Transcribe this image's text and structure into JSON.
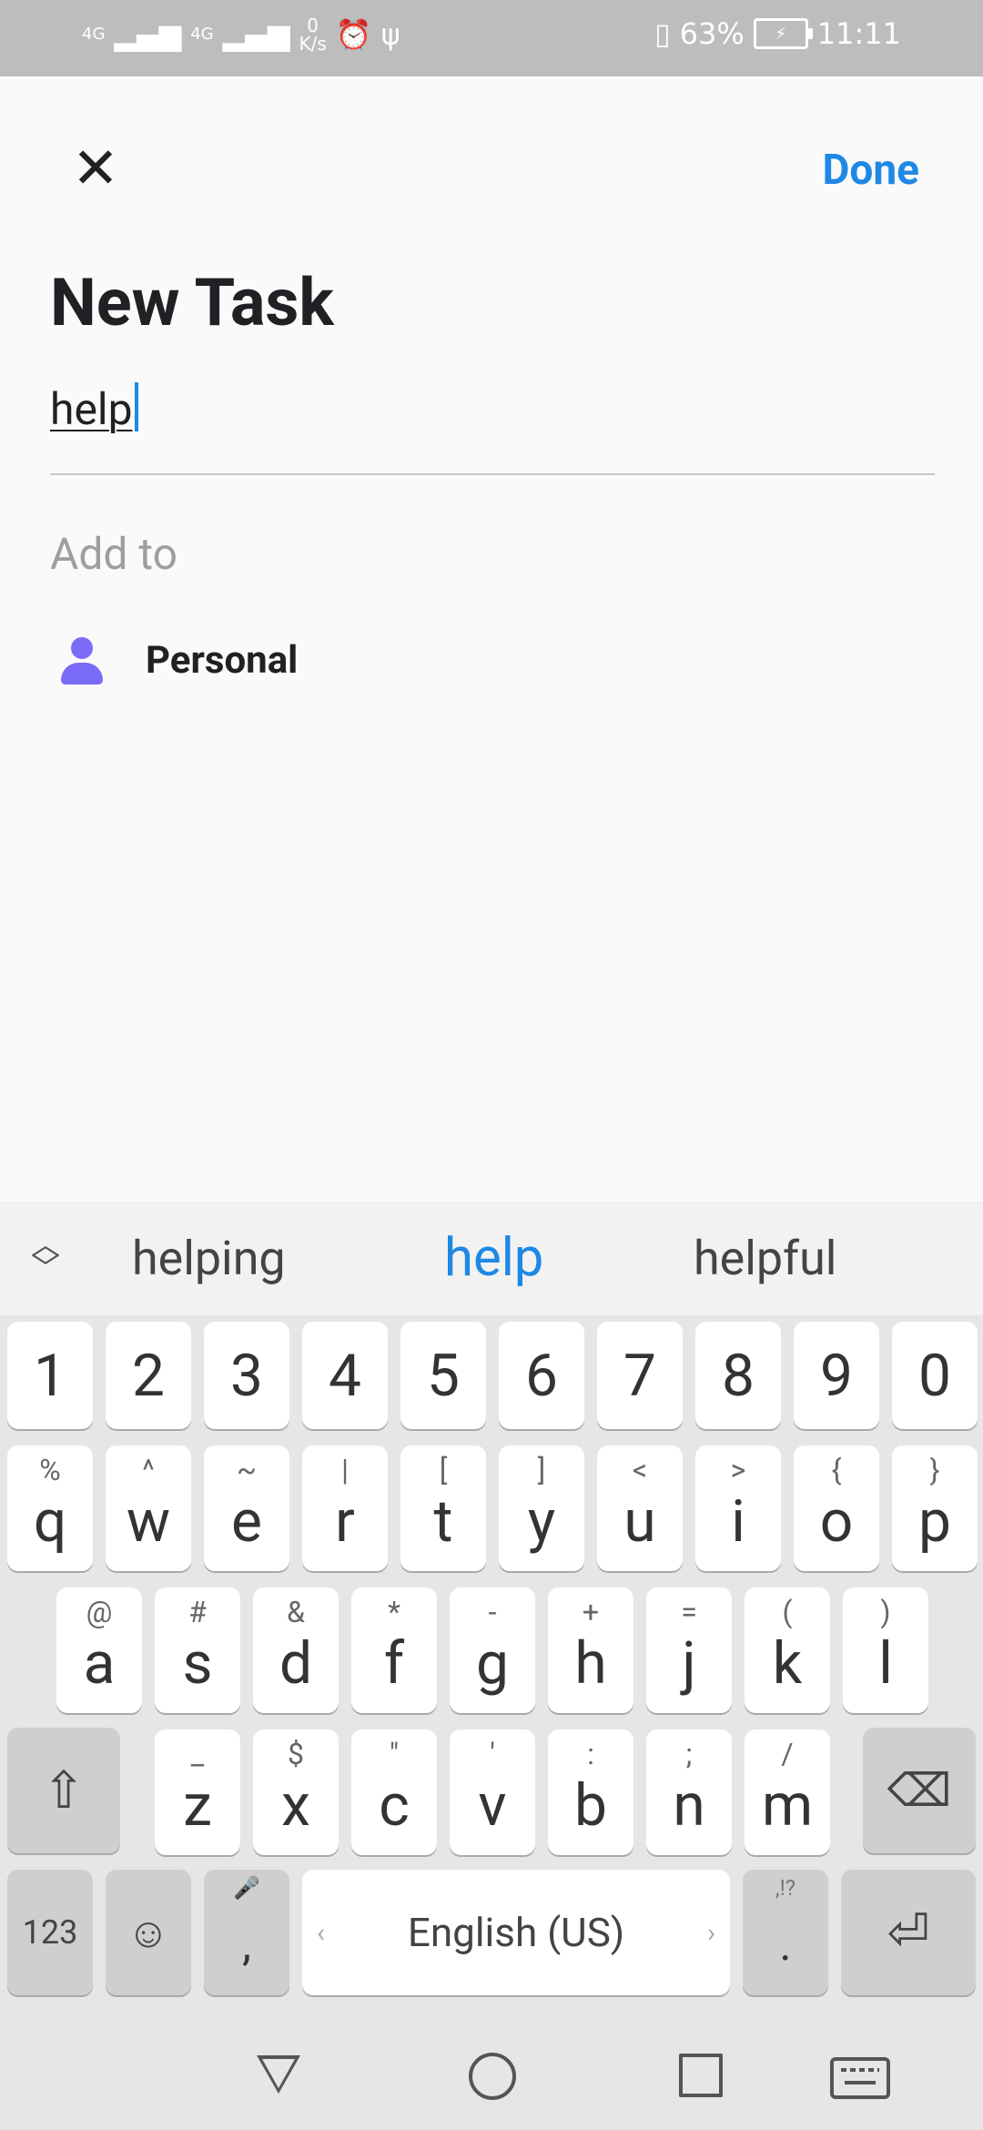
{
  "status_bar": {
    "network1": "4G",
    "network2": "4G",
    "speed_value": "0",
    "speed_unit": "K/s",
    "battery_percent": "63%",
    "time": "11:11",
    "icons": [
      "signal-icon",
      "alarm-icon",
      "usb-icon",
      "vibrate-icon",
      "battery-icon"
    ]
  },
  "header": {
    "close_icon": "close-icon",
    "done_label": "Done"
  },
  "form": {
    "title": "New Task",
    "task_value": "help",
    "add_to_label": "Add to",
    "list": {
      "icon": "person-icon",
      "label": "Personal",
      "icon_color": "#7a6cf6"
    }
  },
  "keyboard": {
    "suggestions": [
      "helping",
      "help",
      "helpful"
    ],
    "number_row": [
      "1",
      "2",
      "3",
      "4",
      "5",
      "6",
      "7",
      "8",
      "9",
      "0"
    ],
    "row1": [
      {
        "main": "q",
        "sub": "%"
      },
      {
        "main": "w",
        "sub": "^"
      },
      {
        "main": "e",
        "sub": "~"
      },
      {
        "main": "r",
        "sub": "|"
      },
      {
        "main": "t",
        "sub": "["
      },
      {
        "main": "y",
        "sub": "]"
      },
      {
        "main": "u",
        "sub": "<"
      },
      {
        "main": "i",
        "sub": ">"
      },
      {
        "main": "o",
        "sub": "{"
      },
      {
        "main": "p",
        "sub": "}"
      }
    ],
    "row2": [
      {
        "main": "a",
        "sub": "@"
      },
      {
        "main": "s",
        "sub": "#"
      },
      {
        "main": "d",
        "sub": "&"
      },
      {
        "main": "f",
        "sub": "*"
      },
      {
        "main": "g",
        "sub": "-"
      },
      {
        "main": "h",
        "sub": "+"
      },
      {
        "main": "j",
        "sub": "="
      },
      {
        "main": "k",
        "sub": "("
      },
      {
        "main": "l",
        "sub": ")"
      }
    ],
    "row3": [
      {
        "main": "z",
        "sub": "_"
      },
      {
        "main": "x",
        "sub": "$"
      },
      {
        "main": "c",
        "sub": "\""
      },
      {
        "main": "v",
        "sub": "'"
      },
      {
        "main": "b",
        "sub": ":"
      },
      {
        "main": "n",
        "sub": ";"
      },
      {
        "main": "m",
        "sub": "/"
      }
    ],
    "mode_key": "123",
    "comma_key": ",",
    "space_label": "English (US)",
    "period_key": ".",
    "period_sub": ",!?",
    "accent_color": "#1e88e5"
  },
  "nav_bar": {
    "icons": [
      "back-icon",
      "home-icon",
      "recents-icon",
      "keyboard-icon"
    ]
  }
}
